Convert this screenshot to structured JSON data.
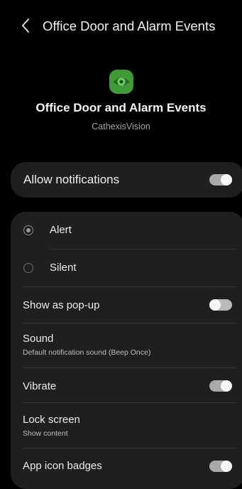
{
  "header": {
    "title": "Office Door and Alarm Events",
    "back_icon": "chevron-left-icon"
  },
  "app": {
    "icon": "eye-icon",
    "icon_color": "#3f9b39",
    "title": "Office Door and Alarm Events",
    "subtitle": "CathexisVision"
  },
  "allow": {
    "label": "Allow notifications",
    "enabled": true
  },
  "settings": {
    "alert_label": "Alert",
    "alert_selected": true,
    "silent_label": "Silent",
    "silent_selected": false,
    "popup_label": "Show as pop-up",
    "popup_enabled": false,
    "sound_label": "Sound",
    "sound_value": "Default notification sound (Beep Once)",
    "vibrate_label": "Vibrate",
    "vibrate_enabled": true,
    "lock_label": "Lock screen",
    "lock_value": "Show content",
    "badges_label": "App icon badges",
    "badges_enabled": true
  }
}
